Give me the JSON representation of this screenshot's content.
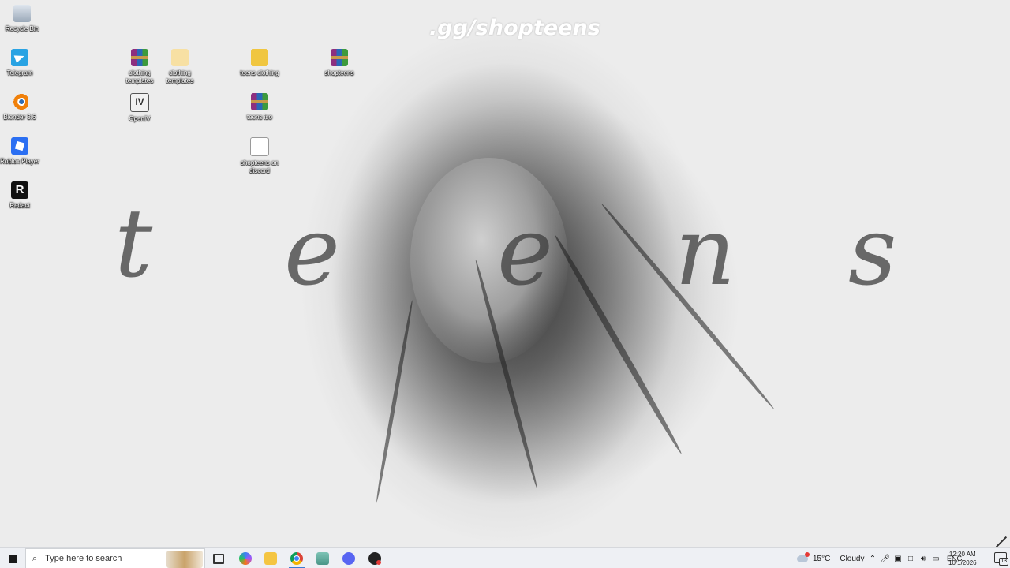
{
  "wallpaper": {
    "title": ".gg/shopteens",
    "letters": [
      "t",
      "e",
      "e",
      "n",
      "s"
    ]
  },
  "desktop_icons": [
    {
      "label": "Recycle Bin",
      "icon": "recycle-bin-icon"
    },
    {
      "label": "Telegram",
      "icon": "telegram-icon"
    },
    {
      "label": "Blender 3.6",
      "icon": "blender-icon"
    },
    {
      "label": "Roblox Player",
      "icon": "roblox-icon"
    },
    {
      "label": "Redact",
      "icon": "redact-icon"
    },
    {
      "label": "clothing templates",
      "icon": "winrar-archive-icon"
    },
    {
      "label": "clothing templates",
      "icon": "folder-icon"
    },
    {
      "label": "OpenIV",
      "icon": "openiv-icon"
    },
    {
      "label": "teens clothing",
      "icon": "archive-folder-icon"
    },
    {
      "label": "teens iso",
      "icon": "winrar-archive-icon"
    },
    {
      "label": "shopteens on discord",
      "icon": "text-document-icon"
    },
    {
      "label": "shopteens",
      "icon": "winrar-archive-icon"
    }
  ],
  "taskbar": {
    "search_placeholder": "Type here to search",
    "apps": [
      {
        "name": "Task View",
        "icon": "task-view-icon"
      },
      {
        "name": "Copilot",
        "icon": "copilot-icon"
      },
      {
        "name": "File Explorer",
        "icon": "file-explorer-icon"
      },
      {
        "name": "Google Chrome",
        "icon": "chrome-icon",
        "active": true
      },
      {
        "name": "Notepad",
        "icon": "notepad-icon"
      },
      {
        "name": "Discord",
        "icon": "discord-icon"
      },
      {
        "name": "Recorder",
        "icon": "recorder-icon"
      }
    ],
    "weather": {
      "temp": "15°C",
      "condition": "Cloudy"
    },
    "language": "ENG",
    "time": "12:20 AM",
    "date": "10/1/2026",
    "notification_count": "13"
  }
}
